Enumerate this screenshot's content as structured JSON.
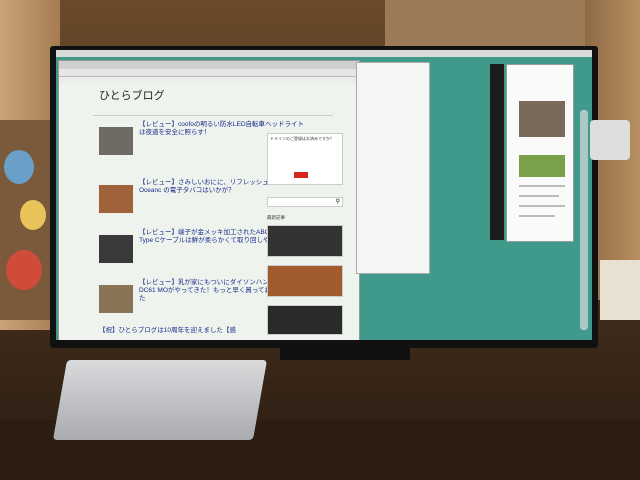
{
  "blog": {
    "title": "ひとらブログ",
    "articles": [
      {
        "title": "【レビュー】coofoの明るい防水LED自転車ヘッドライトは夜道を安全に照らす！"
      },
      {
        "title": "【レビュー】さみしいおにに、リフレッシュ周りにOceanc の電子タバコはいかが？"
      },
      {
        "title": "【レビュー】端子が金メッキ加工されたABOATのUSB Type Cケーブルは鮮が柔らかくて取り回しやすい"
      },
      {
        "title": "【レビュー】乳が家にもついにダイソンハンディ掃除機DC61 MOがやってきた！もっと早く買っておけば良かった"
      },
      {
        "title": "【祝】ひとらブログは10周年を迎えました【感"
      }
    ]
  },
  "sidebar": {
    "domain_box_title": "ドメインのご登録はお済みですか？",
    "recent_label": "最新記事"
  }
}
